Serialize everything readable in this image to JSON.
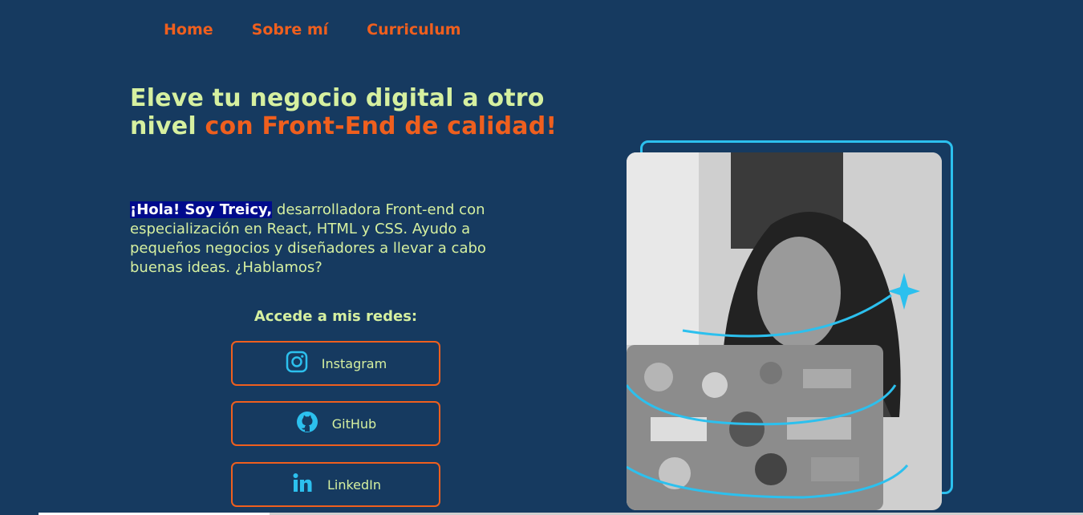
{
  "nav": {
    "items": [
      {
        "label": "Home"
      },
      {
        "label": "Sobre mí"
      },
      {
        "label": "Curriculum"
      }
    ]
  },
  "hero": {
    "headline_part1": "Eleve tu negocio digital a otro nivel ",
    "headline_accent": "con Front-End de calidad!",
    "intro_highlight": "¡Hola! Soy Treicy,",
    "intro_rest": " desarrolladora Front-end con especialización en React, HTML y CSS. Ayudo a pequeños negocios y diseñadores a llevar a cabo buenas ideas. ¿Hablamos?"
  },
  "socials": {
    "title": "Accede a mis redes:",
    "buttons": [
      {
        "label": "Instagram",
        "icon": "instagram-icon"
      },
      {
        "label": "GitHub",
        "icon": "github-icon"
      },
      {
        "label": "LinkedIn",
        "icon": "linkedin-icon"
      }
    ]
  },
  "colors": {
    "background": "#163a60",
    "accent_orange": "#ef5f1e",
    "text_lime": "#d6f0a0",
    "accent_cyan": "#2cc0ee"
  }
}
